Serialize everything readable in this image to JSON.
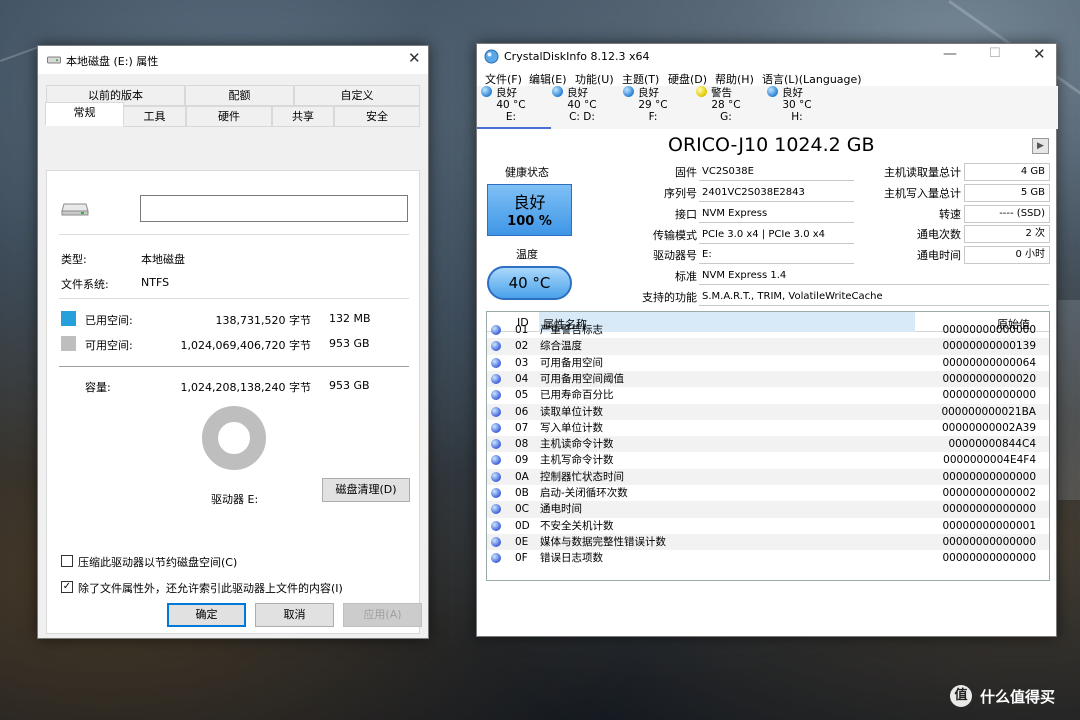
{
  "props": {
    "title": "本地磁盘 (E:) 属性",
    "tabs_row1": [
      "以前的版本",
      "配额",
      "自定义"
    ],
    "tabs_row2": [
      "常规",
      "工具",
      "硬件",
      "共享",
      "安全"
    ],
    "name_value": "",
    "type_label": "类型:",
    "type_value": "本地磁盘",
    "fs_label": "文件系统:",
    "fs_value": "NTFS",
    "used_label": "已用空间:",
    "used_bytes": "138,731,520 字节",
    "used_size": "132 MB",
    "free_label": "可用空间:",
    "free_bytes": "1,024,069,406,720 字节",
    "free_size": "953 GB",
    "cap_label": "容量:",
    "cap_bytes": "1,024,208,138,240 字节",
    "cap_size": "953 GB",
    "drive_label": "驱动器 E:",
    "cleanup_button": "磁盘清理(D)",
    "compress_label": "压缩此驱动器以节约磁盘空间(C)",
    "index_label": "除了文件属性外，还允许索引此驱动器上文件的内容(I)",
    "ok_button": "确定",
    "cancel_button": "取消",
    "apply_button": "应用(A)",
    "used_color": "#26a0da",
    "free_color": "#bebebe",
    "used_fraction": 0.000135
  },
  "cdi": {
    "title": "CrystalDiskInfo 8.12.3 x64",
    "menu": [
      "文件(F)",
      "编辑(E)",
      "功能(U)",
      "主题(T)",
      "硬盘(D)",
      "帮助(H)",
      "语言(L)(Language)"
    ],
    "disks": [
      {
        "status": "良好",
        "temp": "40 °C",
        "letter": "E:",
        "color": "blue"
      },
      {
        "status": "良好",
        "temp": "40 °C",
        "letter": "C: D:",
        "color": "blue"
      },
      {
        "status": "良好",
        "temp": "29 °C",
        "letter": "F:",
        "color": "blue"
      },
      {
        "status": "警告",
        "temp": "28 °C",
        "letter": "G:",
        "color": "yellow"
      },
      {
        "status": "良好",
        "temp": "30 °C",
        "letter": "H:",
        "color": "blue"
      }
    ],
    "model": "ORICO-J10 1024.2 GB",
    "health_label": "健康状态",
    "health_status": "良好",
    "health_percent": "100 %",
    "temp_label": "温度",
    "temp_value": "40 °C",
    "firmware_label": "固件",
    "firmware": "VC2S038E",
    "serial_label": "序列号",
    "serial": "2401VC2S038E2843",
    "interface_label": "接口",
    "interface": "NVM Express",
    "transfer_label": "传输模式",
    "transfer": "PCIe 3.0 x4 | PCIe 3.0 x4",
    "drive_letter_label": "驱动器号",
    "drive_letter": "E:",
    "standard_label": "标准",
    "standard": "NVM Express 1.4",
    "features_label": "支持的功能",
    "features": "S.M.A.R.T., TRIM, VolatileWriteCache",
    "host_reads_label": "主机读取量总计",
    "host_reads": "4 GB",
    "host_writes_label": "主机写入量总计",
    "host_writes": "5 GB",
    "rotation_label": "转速",
    "rotation": "---- (SSD)",
    "power_count_label": "通电次数",
    "power_count": "2 次",
    "power_hours_label": "通电时间",
    "power_hours": "0 小时",
    "table_headers": [
      "ID",
      "属性名称",
      "原始值"
    ],
    "attributes": [
      {
        "id": "01",
        "name": "严重警告标志",
        "raw": "00000000000000"
      },
      {
        "id": "02",
        "name": "综合温度",
        "raw": "00000000000139"
      },
      {
        "id": "03",
        "name": "可用备用空间",
        "raw": "00000000000064"
      },
      {
        "id": "04",
        "name": "可用备用空间阈值",
        "raw": "00000000000020"
      },
      {
        "id": "05",
        "name": "已用寿命百分比",
        "raw": "00000000000000"
      },
      {
        "id": "06",
        "name": "读取单位计数",
        "raw": "000000000021BA"
      },
      {
        "id": "07",
        "name": "写入单位计数",
        "raw": "00000000002A39"
      },
      {
        "id": "08",
        "name": "主机读命令计数",
        "raw": "00000000844C4"
      },
      {
        "id": "09",
        "name": "主机写命令计数",
        "raw": "0000000004E4F4"
      },
      {
        "id": "0A",
        "name": "控制器忙状态时间",
        "raw": "00000000000000"
      },
      {
        "id": "0B",
        "name": "启动-关闭循环次数",
        "raw": "00000000000002"
      },
      {
        "id": "0C",
        "name": "通电时间",
        "raw": "00000000000000"
      },
      {
        "id": "0D",
        "name": "不安全关机计数",
        "raw": "00000000000001"
      },
      {
        "id": "0E",
        "name": "媒体与数据完整性错误计数",
        "raw": "00000000000000"
      },
      {
        "id": "0F",
        "name": "错误日志项数",
        "raw": "00000000000000"
      }
    ]
  },
  "watermark": "值 什么值得买"
}
